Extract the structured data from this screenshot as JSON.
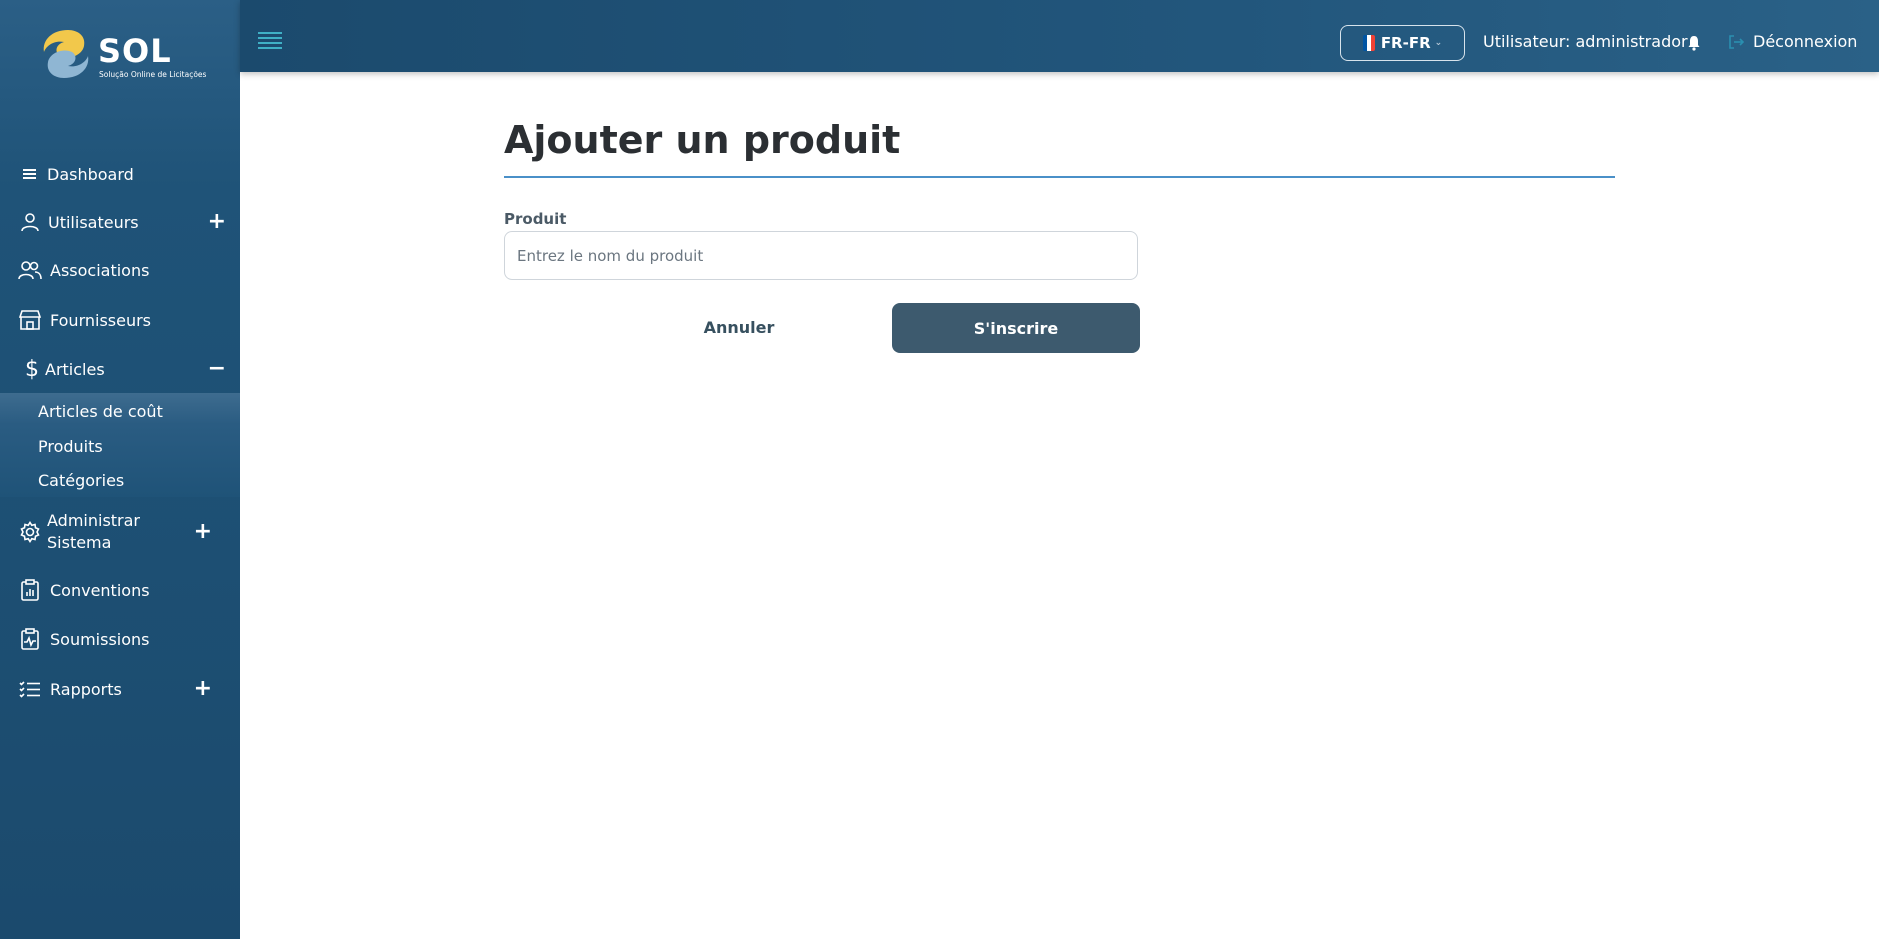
{
  "brand": {
    "name": "SOL",
    "tagline": "Solução Online de Licitações"
  },
  "sidebar": {
    "items": [
      {
        "label": "Dashboard",
        "icon": "list-icon"
      },
      {
        "label": "Utilisateurs",
        "icon": "user-icon",
        "toggle": "+"
      },
      {
        "label": "Associations",
        "icon": "users-icon"
      },
      {
        "label": "Fournisseurs",
        "icon": "store-icon"
      },
      {
        "label": "Articles",
        "icon": "dollar-icon",
        "toggle": "−"
      },
      {
        "label": "Administrar\nSistema",
        "icon": "gear-icon",
        "toggle": "+"
      },
      {
        "label": "Conventions",
        "icon": "clipboard-chart-icon"
      },
      {
        "label": "Soumissions",
        "icon": "clipboard-pulse-icon"
      },
      {
        "label": "Rapports",
        "icon": "checklist-icon",
        "toggle": "+"
      }
    ],
    "sub_items": [
      {
        "label": "Articles de coût"
      },
      {
        "label": "Produits"
      },
      {
        "label": "Catégories"
      }
    ]
  },
  "topbar": {
    "language": "FR-FR",
    "user": "Utilisateur: administrador",
    "logout": "Déconnexion"
  },
  "page": {
    "title": "Ajouter un produit",
    "field_label": "Produit",
    "field_placeholder": "Entrez le nom du produit",
    "field_value": "",
    "cancel": "Annuler",
    "submit": "S'inscrire"
  },
  "colors": {
    "sidebar": "#1f5378",
    "topbar": "#22567c",
    "accent_rule": "#4a90c8",
    "submit_button": "#3d5a6e",
    "hamburger": "#3fb0c6"
  }
}
